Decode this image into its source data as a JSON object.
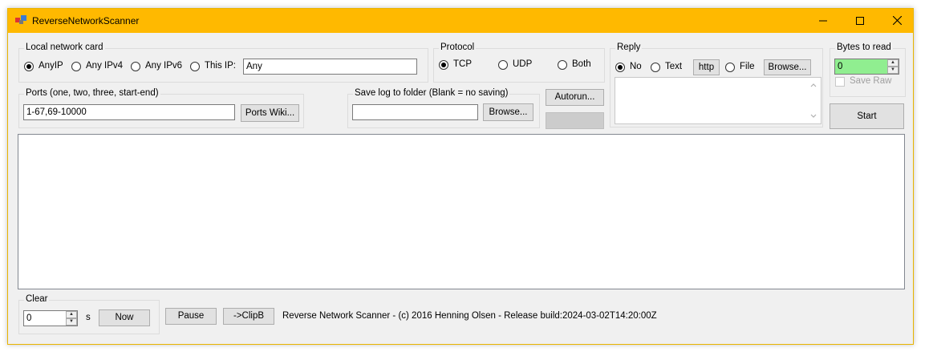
{
  "window": {
    "title": "ReverseNetworkScanner",
    "controls": {
      "minimize": "─",
      "maximize": "☐",
      "close": "✕"
    }
  },
  "local_network_card": {
    "legend": "Local network card",
    "options": [
      "AnyIP",
      "Any IPv4",
      "Any IPv6",
      "This IP:"
    ],
    "selected": "AnyIP",
    "ip_value": "Any"
  },
  "protocol": {
    "legend": "Protocol",
    "options": [
      "TCP",
      "UDP",
      "Both"
    ],
    "selected": "TCP"
  },
  "reply": {
    "legend": "Reply",
    "options": [
      "No",
      "Text",
      "File"
    ],
    "selected": "No",
    "http_button": "http",
    "browse_button": "Browse...",
    "text_value": ""
  },
  "bytes_to_read": {
    "legend": "Bytes to read",
    "value": "0",
    "save_raw_label": "Save Raw",
    "save_raw_checked": false
  },
  "start_button": "Start",
  "ports": {
    "legend": "Ports (one, two, three, start-end)",
    "value": "1-67,69-10000",
    "wiki_button": "Ports Wiki..."
  },
  "save_log": {
    "legend": "Save log to folder (Blank = no saving)",
    "value": "",
    "browse_button": "Browse..."
  },
  "autorun_button": "Autorun...",
  "log_output": "",
  "clear": {
    "legend": "Clear",
    "value": "0",
    "unit": "s",
    "now_button": "Now"
  },
  "pause_button": "Pause",
  "clipboard_button": "->ClipB",
  "status_text": "Reverse Network Scanner - (c) 2016 Henning Olsen - Release build:2024-03-02T14:20:00Z",
  "colors": {
    "titlebar": "#ffb900",
    "bytes_field": "#90ee90"
  }
}
